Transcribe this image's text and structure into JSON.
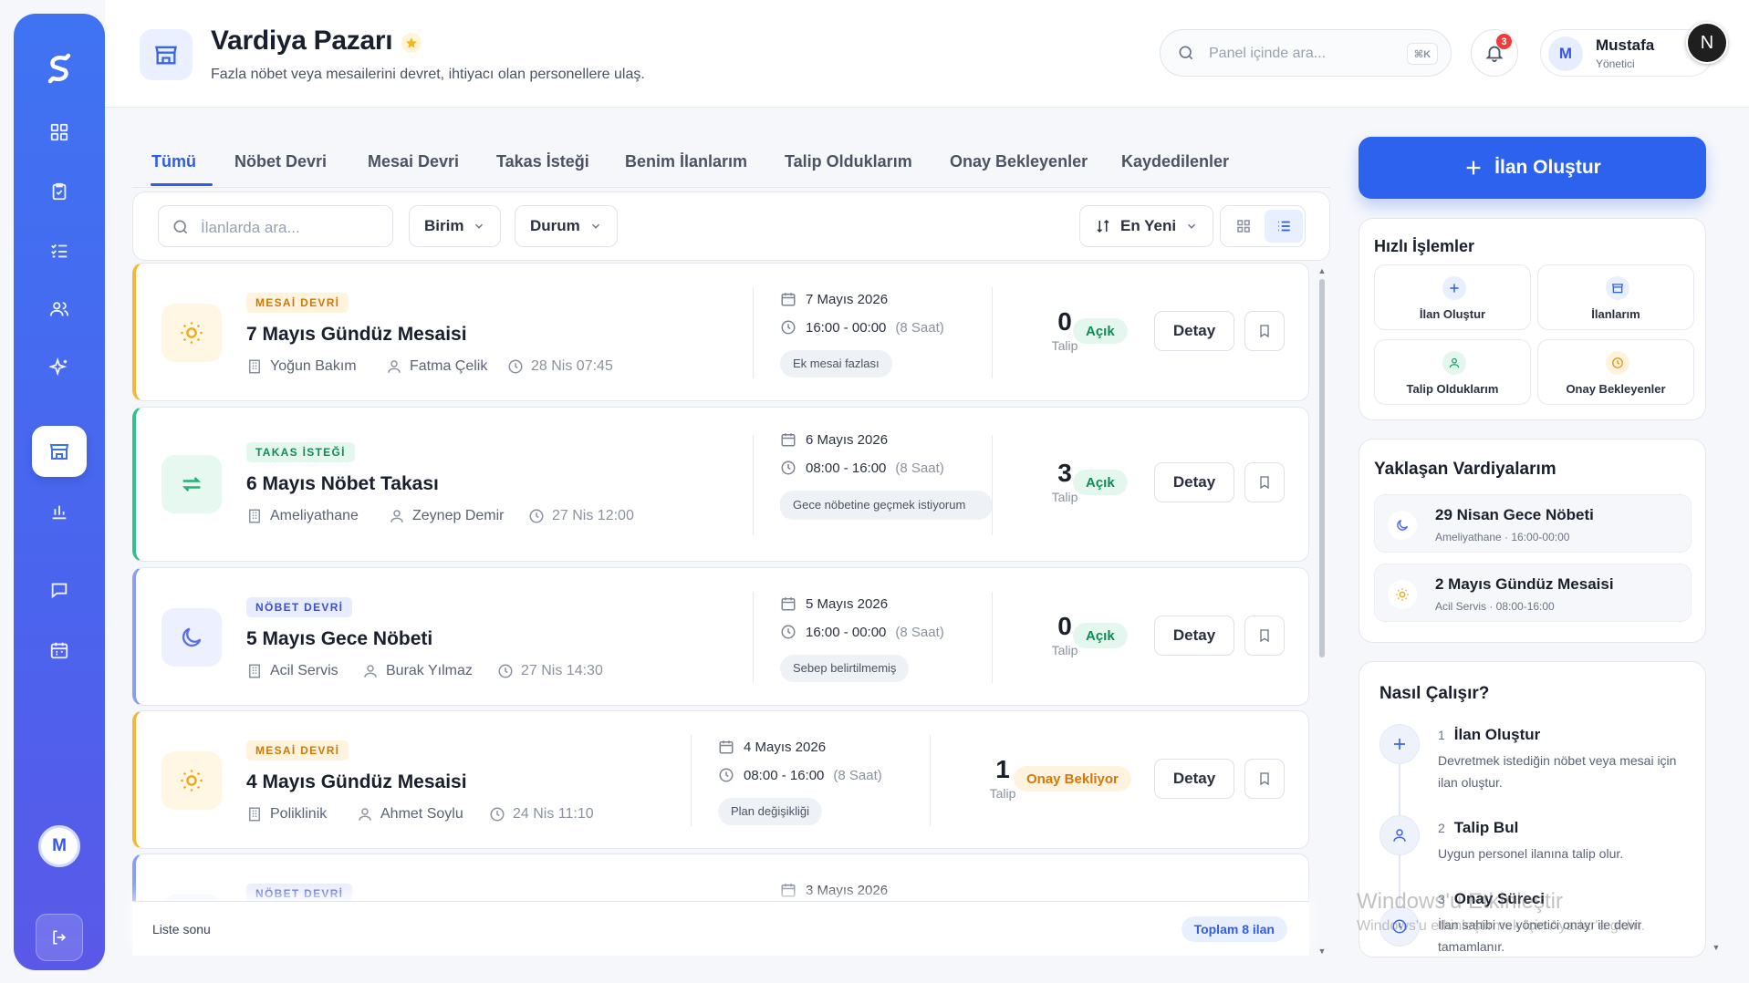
{
  "header": {
    "title": "Vardiya Pazarı",
    "subtitle": "Fazla nöbet veya mesailerini devret, ihtiyacı olan personellere ulaş.",
    "search_placeholder": "Panel içinde ara...",
    "search_shortcut": "⌘K",
    "notification_count": "3",
    "user_initial": "M",
    "user_name": "Mustafa",
    "user_role": "Yönetici",
    "corner_initial": "N"
  },
  "sidebar": {
    "avatar_initial": "M",
    "items": [
      {
        "icon": "dashboard-icon"
      },
      {
        "icon": "clipboard-check-icon"
      },
      {
        "icon": "checklist-icon"
      },
      {
        "icon": "users-icon"
      },
      {
        "icon": "sparkles-icon"
      },
      {
        "icon": "store-icon",
        "active": true
      },
      {
        "icon": "bar-chart-icon"
      },
      {
        "icon": "message-icon"
      },
      {
        "icon": "calendar-icon"
      }
    ]
  },
  "tabs": [
    "Tümü",
    "Nöbet Devri",
    "Mesai Devri",
    "Takas İsteği",
    "Benim İlanlarım",
    "Talip Olduklarım",
    "Onay Bekleyenler",
    "Kaydedilenler"
  ],
  "filters": {
    "search_placeholder": "İlanlarda ara...",
    "unit_label": "Birim",
    "status_label": "Durum",
    "sort_label": "En Yeni"
  },
  "listings": [
    {
      "type": "MESAİ DEVRİ",
      "title": "7 Mayıs Gündüz Mesaisi",
      "dept": "Yoğun Bakım",
      "person": "Fatma Çelik",
      "posted": "28 Nis 07:45",
      "date": "7 Mayıs 2026",
      "time": "16:00 - 00:00",
      "hours": "(8 Saat)",
      "note": "Ek mesai fazlası",
      "count": "0",
      "count_label": "Talip",
      "status": "Açık",
      "detail": "Detay"
    },
    {
      "type": "TAKAS İSTEĞİ",
      "title": "6 Mayıs Nöbet Takası",
      "dept": "Ameliyathane",
      "person": "Zeynep Demir",
      "posted": "27 Nis 12:00",
      "date": "6 Mayıs 2026",
      "time": "08:00 - 16:00",
      "hours": "(8 Saat)",
      "note": "Gece nöbetine geçmek istiyorum",
      "count": "3",
      "count_label": "Talip",
      "status": "Açık",
      "detail": "Detay"
    },
    {
      "type": "NÖBET DEVRİ",
      "title": "5 Mayıs Gece Nöbeti",
      "dept": "Acil Servis",
      "person": "Burak Yılmaz",
      "posted": "27 Nis 14:30",
      "date": "5 Mayıs 2026",
      "time": "16:00 - 00:00",
      "hours": "(8 Saat)",
      "note": "Sebep belirtilmemiş",
      "count": "0",
      "count_label": "Talip",
      "status": "Açık",
      "detail": "Detay"
    },
    {
      "type": "MESAİ DEVRİ",
      "title": "4 Mayıs Gündüz Mesaisi",
      "dept": "Poliklinik",
      "person": "Ahmet Soylu",
      "posted": "24 Nis 11:10",
      "date": "4 Mayıs 2026",
      "time": "08:00 - 16:00",
      "hours": "(8 Saat)",
      "note": "Plan değişikliği",
      "count": "1",
      "count_label": "Talip",
      "status": "Onay Bekliyor",
      "detail": "Detay"
    },
    {
      "type": "NÖBET DEVRİ",
      "date": "3 Mayıs 2026"
    }
  ],
  "list_footer": {
    "end_label": "Liste sonu",
    "total": "Toplam 8 ilan"
  },
  "right": {
    "create_label": "İlan Oluştur",
    "quick_title": "Hızlı İşlemler",
    "quick_actions": [
      "İlan Oluştur",
      "İlanlarım",
      "Talip Olduklarım",
      "Onay Bekleyenler"
    ],
    "upcoming_title": "Yaklaşan Vardiyalarım",
    "upcoming": [
      {
        "title": "29 Nisan Gece Nöbeti",
        "sub": "Ameliyathane · 16:00-00:00"
      },
      {
        "title": "2 Mayıs Gündüz Mesaisi",
        "sub": "Acil Servis · 08:00-16:00"
      }
    ],
    "how_title": "Nasıl Çalışır?",
    "steps": [
      {
        "num": "1",
        "title": "İlan Oluştur",
        "desc": "Devretmek istediğin nöbet veya mesai için ilan oluştur."
      },
      {
        "num": "2",
        "title": "Talip Bul",
        "desc": "Uygun personel ilanına talip olur."
      },
      {
        "num": "3",
        "title": "Onay Süreci",
        "desc": "İlan sahibi ve yönetici onayı ile devir tamamlanır."
      }
    ]
  },
  "watermark": {
    "line1": "Windows'u Etkinleştir",
    "line2": "Windows'u etkinleştirmek için Ayarlar'a gidin."
  },
  "colors": {
    "primary": "#2d62ee",
    "orange": "#f3b73a",
    "green": "#34c08a",
    "indigo": "#8a9df0"
  }
}
